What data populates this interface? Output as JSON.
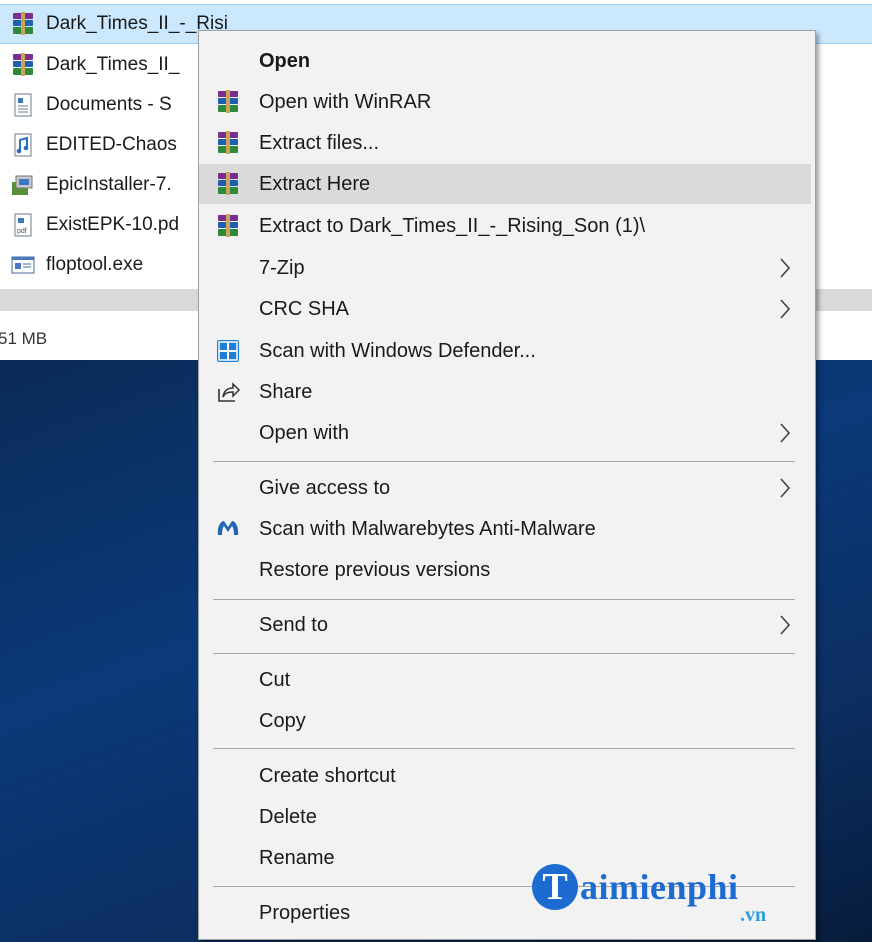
{
  "explorer": {
    "files": [
      {
        "name": "Dark_Times_II_-_Risi",
        "icon": "winrar-archive-icon"
      },
      {
        "name": "Dark_Times_II_",
        "icon": "winrar-archive-icon"
      },
      {
        "name": "Documents - S",
        "icon": "document-file-icon"
      },
      {
        "name": "EDITED-Chaos",
        "icon": "audio-file-icon"
      },
      {
        "name": "EpicInstaller-7.",
        "icon": "installer-package-icon"
      },
      {
        "name": "ExistEPK-10.pd",
        "icon": "pdf-file-icon"
      },
      {
        "name": "floptool.exe",
        "icon": "exe-app-icon"
      }
    ],
    "status_size": "51 MB"
  },
  "context_menu": {
    "items": [
      {
        "label": "Open",
        "icon": null,
        "bold": true,
        "submenu": false
      },
      {
        "label": "Open with WinRAR",
        "icon": "winrar-icon",
        "submenu": false
      },
      {
        "label": "Extract files...",
        "icon": "winrar-icon",
        "submenu": false
      },
      {
        "label": "Extract Here",
        "icon": "winrar-icon",
        "submenu": false,
        "highlighted": true
      },
      {
        "label": "Extract to Dark_Times_II_-_Rising_Son (1)\\",
        "icon": "winrar-icon",
        "submenu": false
      },
      {
        "label": "7-Zip",
        "icon": null,
        "submenu": true
      },
      {
        "label": "CRC SHA",
        "icon": null,
        "submenu": true
      },
      {
        "label": "Scan with Windows Defender...",
        "icon": "windows-defender-icon",
        "submenu": false
      },
      {
        "label": "Share",
        "icon": "share-icon",
        "submenu": false
      },
      {
        "label": "Open with",
        "icon": null,
        "submenu": true
      },
      {
        "label": "Give access to",
        "icon": null,
        "submenu": true
      },
      {
        "label": "Scan with Malwarebytes Anti-Malware",
        "icon": "malwarebytes-icon",
        "submenu": false
      },
      {
        "label": "Restore previous versions",
        "icon": null,
        "submenu": false
      },
      {
        "label": "Send to",
        "icon": null,
        "submenu": true
      },
      {
        "label": "Cut",
        "icon": null,
        "submenu": false
      },
      {
        "label": "Copy",
        "icon": null,
        "submenu": false
      },
      {
        "label": "Create shortcut",
        "icon": null,
        "submenu": false
      },
      {
        "label": "Delete",
        "icon": null,
        "submenu": false
      },
      {
        "label": "Rename",
        "icon": null,
        "submenu": false
      },
      {
        "label": "Properties",
        "icon": null,
        "submenu": false
      }
    ]
  },
  "watermark": {
    "logo_letter": "T",
    "text": "aimienphi",
    "suffix": ".vn"
  },
  "colors": {
    "selection": "#cce8ff",
    "menu_background": "#f2f2f2",
    "menu_hover": "#dadada",
    "watermark_blue": "#1b6bd1"
  }
}
